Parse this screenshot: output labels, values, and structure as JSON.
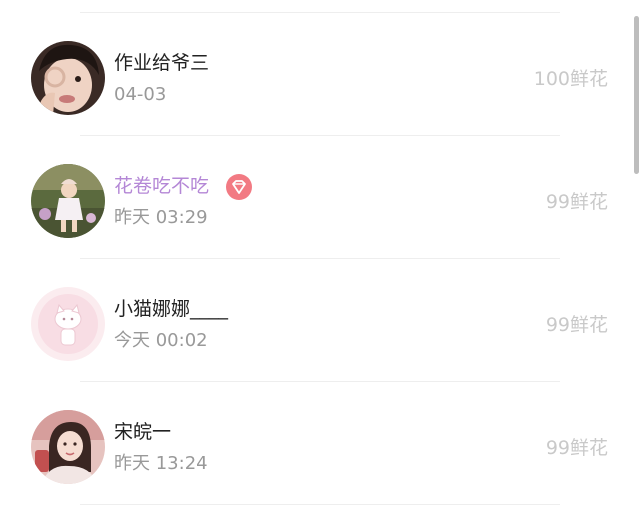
{
  "users": [
    {
      "name": "作业给爷三",
      "time": "04-03",
      "flowers": "100鲜花",
      "vip": false,
      "avatar_icon": "girl-face-avatar-icon"
    },
    {
      "name": "花卷吃不吃",
      "time": "昨天 03:29",
      "flowers": "99鲜花",
      "vip": true,
      "avatar_icon": "outdoor-girl-avatar-icon"
    },
    {
      "name": "小猫娜娜____",
      "time": "今天 00:02",
      "flowers": "99鲜花",
      "vip": false,
      "avatar_icon": "pink-kitty-avatar-icon"
    },
    {
      "name": "宋皖一",
      "time": "昨天 13:24",
      "flowers": "99鲜花",
      "vip": false,
      "avatar_icon": "girl-portrait-avatar-icon"
    }
  ],
  "badge_icon": "diamond-vip-icon",
  "colors": {
    "name": "#222222",
    "vip_name": "#b487d6",
    "time": "#999999",
    "flowers": "#c9c9c9",
    "badge": "#f27a83",
    "divider": "#eeeeee"
  }
}
